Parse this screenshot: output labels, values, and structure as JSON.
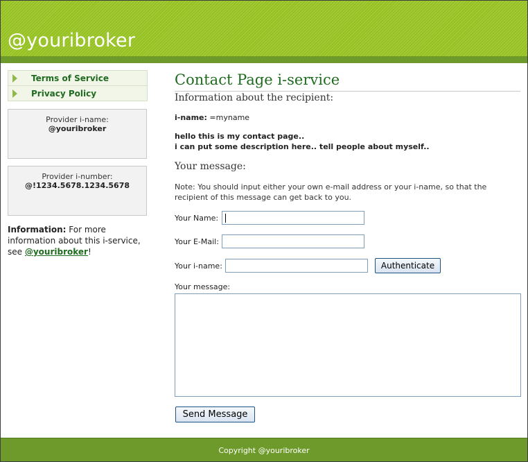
{
  "header": {
    "site_title": "@youribroker"
  },
  "nav": {
    "items": [
      {
        "label": "Terms of Service"
      },
      {
        "label": "Privacy Policy"
      }
    ]
  },
  "provider_name": {
    "label": "Provider i-name:",
    "value": "@youribroker"
  },
  "provider_number": {
    "label": "Provider i-number:",
    "value": "@!1234.5678.1234.5678"
  },
  "info": {
    "lead": "Information:",
    "text": " For more information about this i-service, see ",
    "link": "@youribroker",
    "end": "!"
  },
  "main": {
    "title": "Contact Page i-service",
    "recipient_heading": "Information about the recipient:",
    "iname_label": "i-name:",
    "iname_value": " =myname",
    "desc_line1": "hello this is my contact page..",
    "desc_line2": "i can put some description here.. tell people about myself..",
    "message_heading": "Your message:",
    "note": "Note: You should input either your own e-mail address or your i-name, so that the recipient of this message can get back to you."
  },
  "form": {
    "name_label": "Your Name:",
    "name_value": "",
    "email_label": "Your E-Mail:",
    "email_value": "",
    "iname_label": "Your i-name:",
    "iname_value": "",
    "authenticate_label": "Authenticate",
    "message_label": "Your message:",
    "message_value": "",
    "send_label": "Send Message"
  },
  "footer": {
    "copyright": "Copyright @youribroker"
  }
}
